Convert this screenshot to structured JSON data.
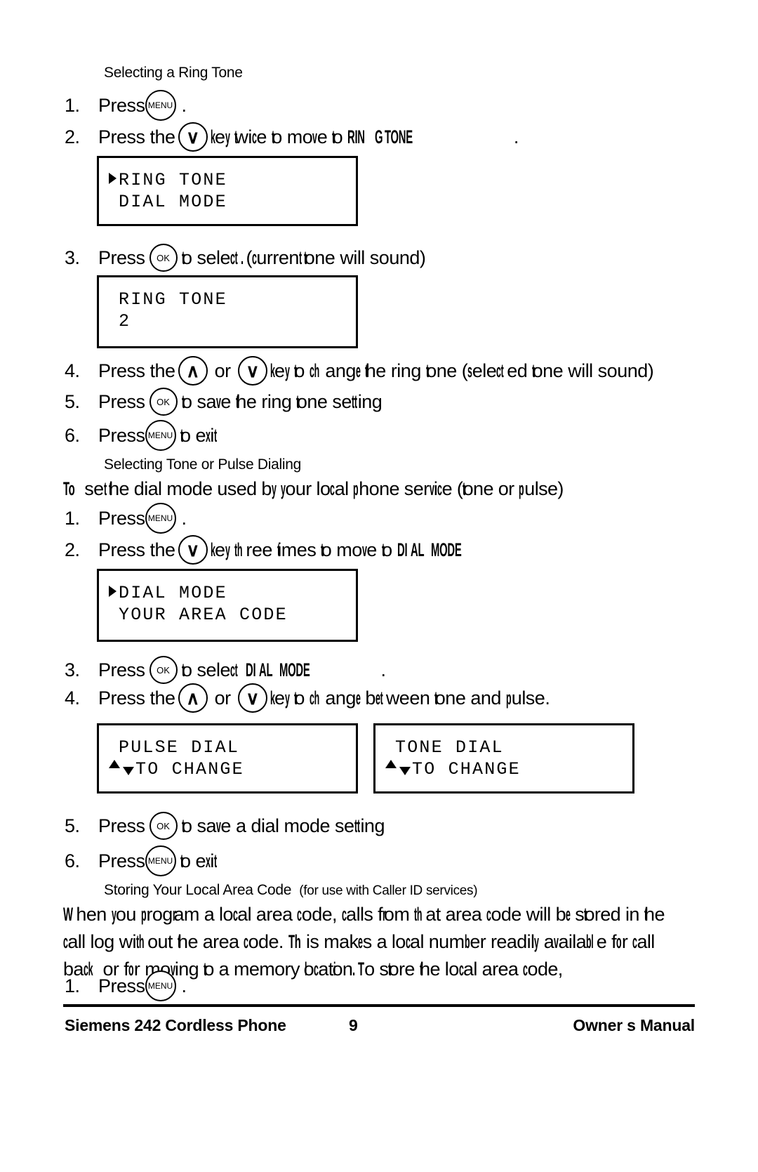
{
  "document": {
    "title": "Siemens 242 Cordless Phone Owner's Manual",
    "page_number": "9"
  },
  "sections": [
    {
      "heading": "Selecting a Ring Tone",
      "steps": [
        {
          "num": "1.",
          "pre": "Press",
          "key": "MENU",
          "post": "."
        },
        {
          "num": "2.",
          "pre": "Press the",
          "key": "∨",
          "post": "key twice to move to RING TONE",
          "end": "."
        },
        {
          "num": "3.",
          "pre": "Press",
          "key": "OK",
          "post": "to select. (current tone will sound)"
        },
        {
          "num": "4.",
          "pre": "Press the",
          "key": "∧",
          "mid": "or",
          "key2": "∨",
          "post": "key to change the ring tone (selected tone will sound)"
        },
        {
          "num": "5.",
          "pre": "Press",
          "key": "OK",
          "post": "to save the ring tone setting"
        },
        {
          "num": "6.",
          "pre": "Press",
          "key": "MENU",
          "post": "to exit"
        }
      ],
      "screens": [
        {
          "name": "ring-tone-menu",
          "marker": true,
          "line1": "RING TONE",
          "line2": "DIAL MODE"
        },
        {
          "name": "ring-tone-value",
          "marker": false,
          "line1": "RING TONE",
          "line2": "2"
        }
      ]
    },
    {
      "heading": "Selecting Tone or Pulse Dialing",
      "intro": "To set the dial mode used by your local phone service (tone or pulse)",
      "steps": [
        {
          "num": "1.",
          "pre": "Press",
          "key": "MENU",
          "post": "."
        },
        {
          "num": "2.",
          "pre": "Press the",
          "key": "∨",
          "post": "key three times to move to DIAL MODE"
        },
        {
          "num": "3.",
          "pre": "Press",
          "key": "OK",
          "post": "to select DIAL MODE",
          "end": "."
        },
        {
          "num": "4.",
          "pre": "Press the",
          "key": "∧",
          "mid": "or",
          "key2": "∨",
          "post": "key to change between tone and pulse."
        },
        {
          "num": "5.",
          "pre": "Press",
          "key": "OK",
          "post": "to save a dial mode setting"
        },
        {
          "num": "6.",
          "pre": "Press",
          "key": "MENU",
          "post": "to exit"
        }
      ],
      "screens": [
        {
          "name": "dial-mode-menu",
          "marker": true,
          "line1": "DIAL MODE",
          "line2": "YOUR AREA CODE"
        },
        {
          "name": "pulse-dial",
          "marker": false,
          "line1": "PULSE DIAL",
          "line2": "TO CHANGE"
        },
        {
          "name": "tone-dial",
          "marker": false,
          "line1": "TONE DIAL",
          "line2": "TO CHANGE"
        }
      ]
    },
    {
      "heading": "Storing Your Local Area Code",
      "heading_note": "(for use with Caller ID services)",
      "paragraph": [
        "When you program a local area code, calls from that area code will be stored in the",
        "call log without the area code. This makes a local number readily available for call",
        "back or for moving to a memory location. To store the local area code,"
      ],
      "steps": [
        {
          "num": "1.",
          "pre": "Press",
          "key": "MENU",
          "post": "."
        }
      ]
    }
  ],
  "footer": {
    "left": "Siemens 242 Cordless Phone",
    "center": "9",
    "right": "Owner s Manual"
  }
}
